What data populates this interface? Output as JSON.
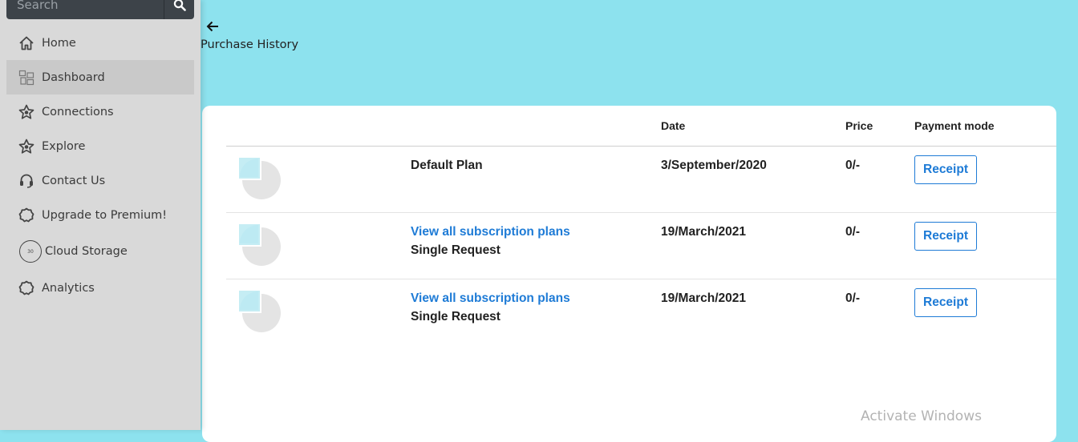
{
  "search": {
    "placeholder": "Search"
  },
  "sidebar": {
    "items": [
      {
        "label": "Home",
        "icon": "home-icon"
      },
      {
        "label": "Dashboard",
        "icon": "dashboard-icon",
        "active": true
      },
      {
        "label": "Connections",
        "icon": "star-badge-icon"
      },
      {
        "label": "Explore",
        "icon": "star-badge-icon"
      },
      {
        "label": "Contact Us",
        "icon": "headset-icon"
      },
      {
        "label": "Upgrade to Premium!",
        "icon": "gear-icon"
      },
      {
        "label": "Cloud Storage",
        "icon": "storage-circle-icon",
        "badge": "30"
      },
      {
        "label": "Analytics",
        "icon": "gear-icon"
      }
    ]
  },
  "header": {
    "title": "Purchase History"
  },
  "table": {
    "headers": {
      "date": "Date",
      "price": "Price",
      "payment_mode": "Payment mode"
    },
    "rows": [
      {
        "link": "",
        "name": "Default Plan",
        "date": "3/September/2020",
        "price": "0/-",
        "action": "Receipt"
      },
      {
        "link": "View all subscription plans",
        "name": "Single Request",
        "date": "19/March/2021",
        "price": "0/-",
        "action": "Receipt"
      },
      {
        "link": "View all subscription plans",
        "name": "Single Request",
        "date": "19/March/2021",
        "price": "0/-",
        "action": "Receipt"
      }
    ]
  },
  "watermark": "Activate Windows",
  "colors": {
    "background": "#8de2ee",
    "sidebar": "#d9d9d9",
    "link": "#1e7bd6",
    "search_bar": "#3d4349"
  }
}
